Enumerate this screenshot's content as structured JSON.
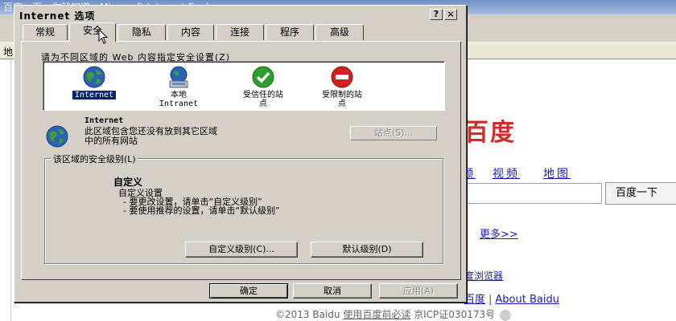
{
  "browser": {
    "title": "百度一下，你就知道 - Microsoft Internet Explorer",
    "address_letter": "地",
    "logo_fragment": "百度",
    "nav_links": [
      "频",
      "视频",
      "地图"
    ],
    "search_button": "百度一下",
    "more_link": "更多>>",
    "more_bar": "|",
    "browser_link": "度浏览器",
    "about_left": "百度",
    "about_sep": "|",
    "about_right": "About Baidu",
    "footer_prefix": "©2013 Baidu ",
    "footer_link": "使用百度前必读",
    "footer_icp": " 京ICP证030173号"
  },
  "dialog": {
    "title": "Internet 选项",
    "help_label": "?",
    "close_label": "×",
    "tabs": [
      {
        "label": "常规",
        "active": false
      },
      {
        "label": "安全",
        "active": true
      },
      {
        "label": "隐私",
        "active": false
      },
      {
        "label": "内容",
        "active": false
      },
      {
        "label": "连接",
        "active": false
      },
      {
        "label": "程序",
        "active": false
      },
      {
        "label": "高级",
        "active": false
      }
    ],
    "zone_prompt": "请为不同区域的 Web 内容指定安全设置(Z)",
    "zones": [
      {
        "line1": "Internet",
        "line2": "",
        "icon": "globe-icon"
      },
      {
        "line1": "本地",
        "line2": "Intranet",
        "icon": "local-intranet-icon"
      },
      {
        "line1": "受信任的站",
        "line2": "点",
        "icon": "trusted-sites-icon"
      },
      {
        "line1": "受限制的站",
        "line2": "点",
        "icon": "restricted-sites-icon"
      }
    ],
    "zone_desc_title": "Internet",
    "zone_desc_line1": "此区域包含您还没有放到其它区域",
    "zone_desc_line2": "中的所有网站",
    "sites_button": "站点(S)...",
    "security_group_label": "该区域的安全级别(L)",
    "level_title": "自定义",
    "level_line1": "自定义设置",
    "level_line2": "- 要更改设置，请单击“自定义级别”",
    "level_line3": "- 要使用推荐的设置，请单击“默认级别”",
    "custom_level_button": "自定义级别(C)...",
    "default_level_button": "默认级别(D)",
    "ok_button": "确定",
    "cancel_button": "取消",
    "apply_button": "应用(A)"
  },
  "colors": {
    "dialog_face": "#d4d0c8",
    "selection": "#0a246a",
    "baidu_red": "#d52a2a",
    "link_blue": "#1a1ab8"
  }
}
